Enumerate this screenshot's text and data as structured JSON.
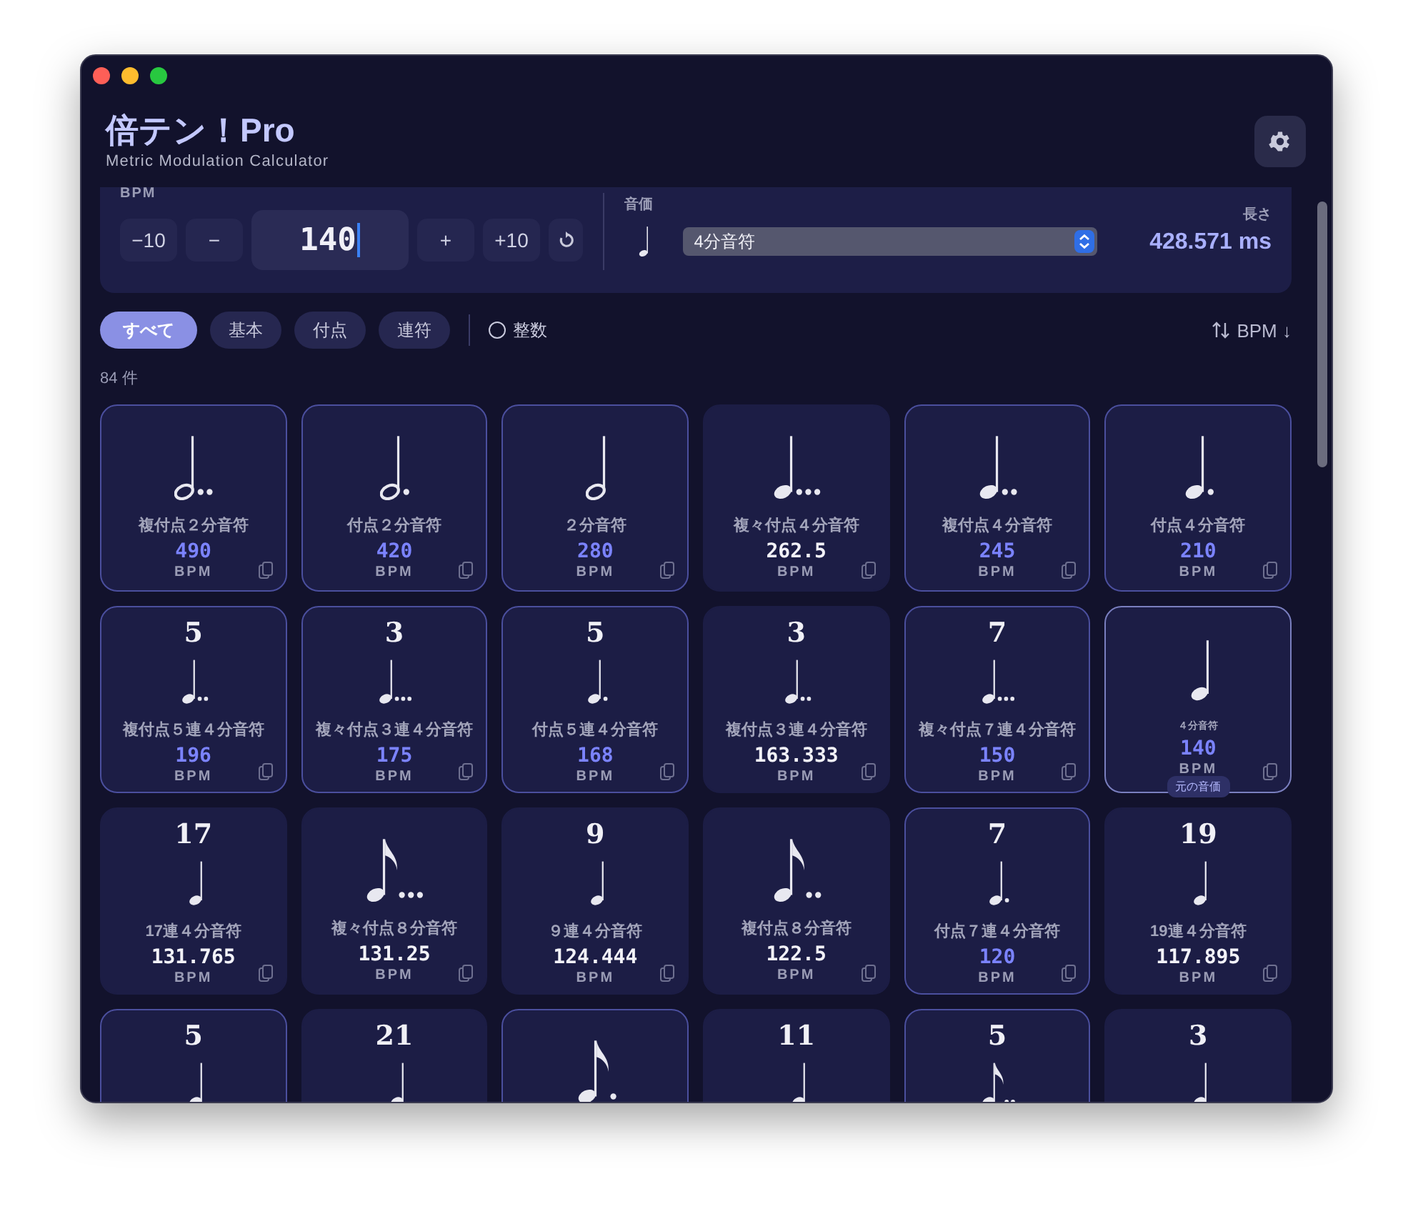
{
  "app": {
    "title": "倍テン！Pro",
    "subtitle": "Metric Modulation Calculator"
  },
  "bpm": {
    "label": "BPM",
    "value": "140",
    "buttons": [
      "−10",
      "−",
      "+",
      "+10"
    ]
  },
  "note_value": {
    "label": "音価",
    "kind": "quarter",
    "selected": "4分音符"
  },
  "length": {
    "label": "長さ",
    "value": "428.571 ms"
  },
  "filters": [
    {
      "label": "すべて",
      "selected": true
    },
    {
      "label": "基本",
      "selected": false
    },
    {
      "label": "付点",
      "selected": false
    },
    {
      "label": "連符",
      "selected": false
    }
  ],
  "integer_toggle": {
    "label": "整数",
    "checked": false
  },
  "sort": {
    "label": "BPM ↓"
  },
  "count": "84 件",
  "cards": [
    {
      "kind": "doubleDottedHalf",
      "name": "複付点２分音符",
      "bpm": "490",
      "unit": "BPM",
      "integer": true
    },
    {
      "kind": "dottedHalf",
      "name": "付点２分音符",
      "bpm": "420",
      "unit": "BPM",
      "integer": true
    },
    {
      "kind": "half",
      "name": "２分音符",
      "bpm": "280",
      "unit": "BPM",
      "integer": true
    },
    {
      "kind": "tripleDottedQuarter",
      "name": "複々付点４分音符",
      "bpm": "262.5",
      "unit": "BPM",
      "integer": false
    },
    {
      "kind": "doubleDottedQuarter",
      "name": "複付点４分音符",
      "bpm": "245",
      "unit": "BPM",
      "integer": true
    },
    {
      "kind": "dottedQuarter",
      "name": "付点４分音符",
      "bpm": "210",
      "unit": "BPM",
      "integer": true
    },
    {
      "tuplet": "5",
      "kind": "doubleDottedQuarter",
      "name": "複付点５連４分音符",
      "bpm": "196",
      "unit": "BPM",
      "integer": true
    },
    {
      "tuplet": "3",
      "kind": "tripleDottedQuarter",
      "name": "複々付点３連４分音符",
      "bpm": "175",
      "unit": "BPM",
      "integer": true
    },
    {
      "tuplet": "5",
      "kind": "dottedQuarter",
      "name": "付点５連４分音符",
      "bpm": "168",
      "unit": "BPM",
      "integer": true
    },
    {
      "tuplet": "3",
      "kind": "doubleDottedQuarter",
      "name": "複付点３連４分音符",
      "bpm": "163.333",
      "unit": "BPM",
      "integer": false
    },
    {
      "tuplet": "7",
      "kind": "tripleDottedQuarter",
      "name": "複々付点７連４分音符",
      "bpm": "150",
      "unit": "BPM",
      "integer": true
    },
    {
      "kind": "quarter",
      "name": "４分音符",
      "bpm": "140",
      "unit": "BPM",
      "integer": true,
      "original": true,
      "badge": "元の音価"
    },
    {
      "tuplet": "17",
      "kind": "quarter",
      "name": "17連４分音符",
      "bpm": "131.765",
      "unit": "BPM",
      "integer": false
    },
    {
      "kind": "tripleDottedEighth",
      "name": "複々付点８分音符",
      "bpm": "131.25",
      "unit": "BPM",
      "integer": false
    },
    {
      "tuplet": "9",
      "kind": "quarter",
      "name": "９連４分音符",
      "bpm": "124.444",
      "unit": "BPM",
      "integer": false
    },
    {
      "kind": "doubleDottedEighth",
      "name": "複付点８分音符",
      "bpm": "122.5",
      "unit": "BPM",
      "integer": false
    },
    {
      "tuplet": "7",
      "kind": "dottedQuarter",
      "name": "付点７連４分音符",
      "bpm": "120",
      "unit": "BPM",
      "integer": true
    },
    {
      "tuplet": "19",
      "kind": "quarter",
      "name": "19連４分音符",
      "bpm": "117.895",
      "unit": "BPM",
      "integer": false
    },
    {
      "tuplet": "5",
      "kind": "quarter",
      "integer": true
    },
    {
      "tuplet": "21",
      "kind": "quarter",
      "integer": false
    },
    {
      "kind": "dottedEighth",
      "integer": true
    },
    {
      "tuplet": "11",
      "kind": "quarter",
      "integer": false
    },
    {
      "tuplet": "5",
      "kind": "doubleDottedEighth",
      "integer": true
    },
    {
      "tuplet": "3",
      "kind": "quarter",
      "integer": false
    }
  ]
}
